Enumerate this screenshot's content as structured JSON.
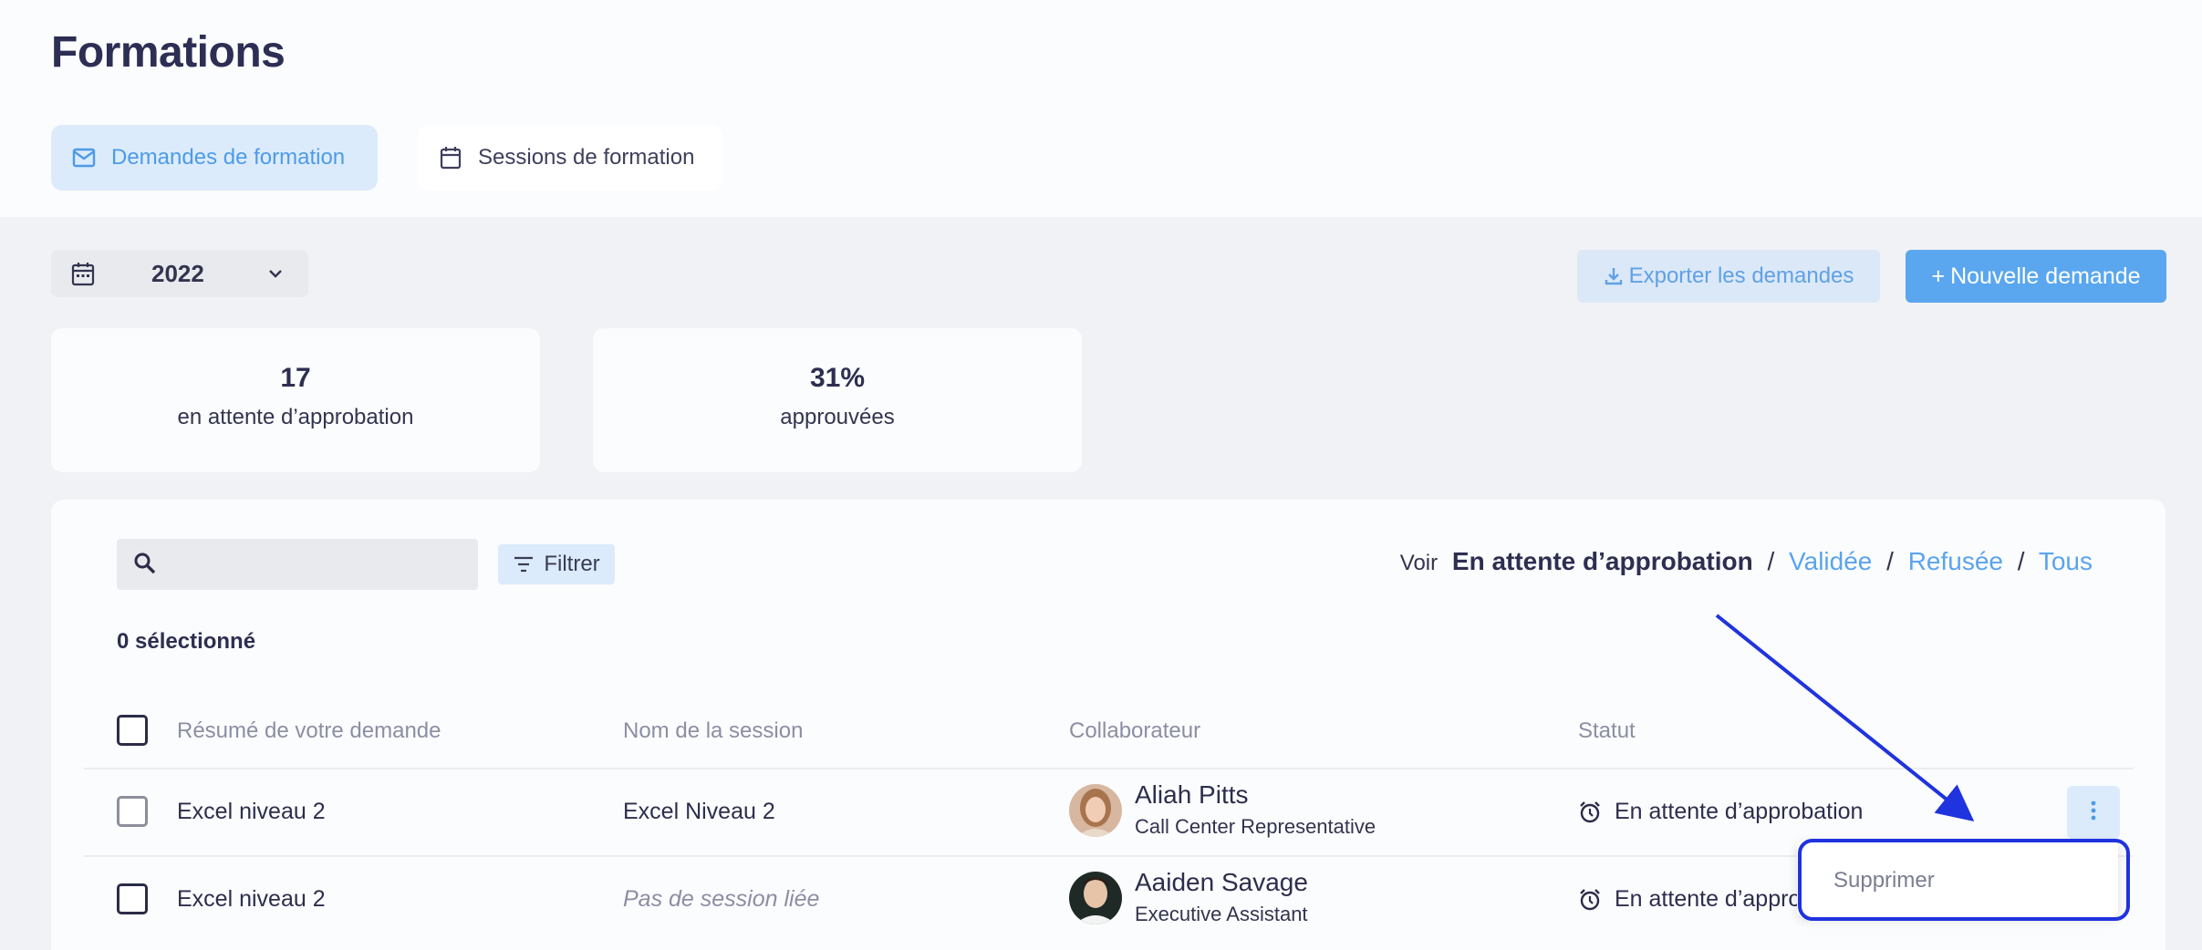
{
  "page": {
    "title": "Formations"
  },
  "tabs": [
    {
      "label": "Demandes de formation",
      "icon": "mail-icon",
      "active": true
    },
    {
      "label": "Sessions de formation",
      "icon": "calendar-icon",
      "active": false
    }
  ],
  "toolbar": {
    "year": "2022",
    "export_label": "Exporter les demandes",
    "new_label": "Nouvelle demande",
    "new_prefix": "+"
  },
  "stats": [
    {
      "value": "17",
      "label": "en attente d’approbation"
    },
    {
      "value": "31%",
      "label": "approuvées"
    }
  ],
  "filters": {
    "search_placeholder": "",
    "filter_label": "Filtrer",
    "view_prefix": "Voir",
    "view_current": "En attente d’approbation",
    "view_links": [
      "Validée",
      "Refusée",
      "Tous"
    ],
    "separator": "/"
  },
  "selection": {
    "count_label": "0 sélectionné"
  },
  "table": {
    "headers": [
      "Résumé de votre demande",
      "Nom de la session",
      "Collaborateur",
      "Statut"
    ],
    "rows": [
      {
        "summary": "Excel niveau 2",
        "session": "Excel Niveau 2",
        "session_linked": true,
        "name": "Aliah Pitts",
        "role": "Call Center Representative",
        "status": "En attente d’approbation"
      },
      {
        "summary": "Excel niveau 2",
        "session": "Pas de session liée",
        "session_linked": false,
        "name": "Aaiden Savage",
        "role": "Executive Assistant",
        "status": "En attente d’appro"
      }
    ]
  },
  "menu": {
    "delete_label": "Supprimer"
  },
  "colors": {
    "accent": "#5aa7ef",
    "accent_light": "#dcebfb",
    "annotation": "#1f33de"
  }
}
